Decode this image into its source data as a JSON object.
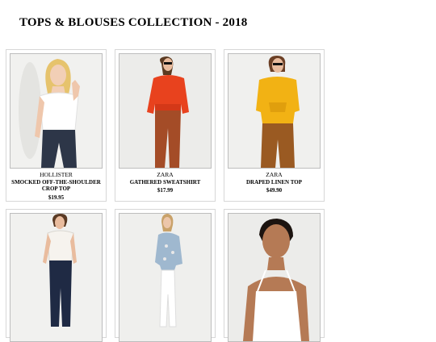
{
  "page": {
    "title": "TOPS & BLOUSES COLLECTION - 2018"
  },
  "products": [
    {
      "brand": "HOLLISTER",
      "name": "SMOCKED OFF-THE-SHOULDER CROP TOP",
      "price": "$19.95"
    },
    {
      "brand": "ZARA",
      "name": "GATHERED SWEATSHIRT",
      "price": "$17.99"
    },
    {
      "brand": "ZARA",
      "name": "DRAPED LINEN TOP",
      "price": "$49.90"
    },
    {
      "brand": "",
      "name": "",
      "price": ""
    },
    {
      "brand": "",
      "name": "",
      "price": ""
    },
    {
      "brand": "",
      "name": "",
      "price": ""
    }
  ],
  "colors": {
    "card_border": "#d7d7d7",
    "photo_border": "#bdbdbd",
    "top_orange": "#e8421e",
    "top_yellow": "#f2b214",
    "trousers_rust": "#a44c27"
  }
}
